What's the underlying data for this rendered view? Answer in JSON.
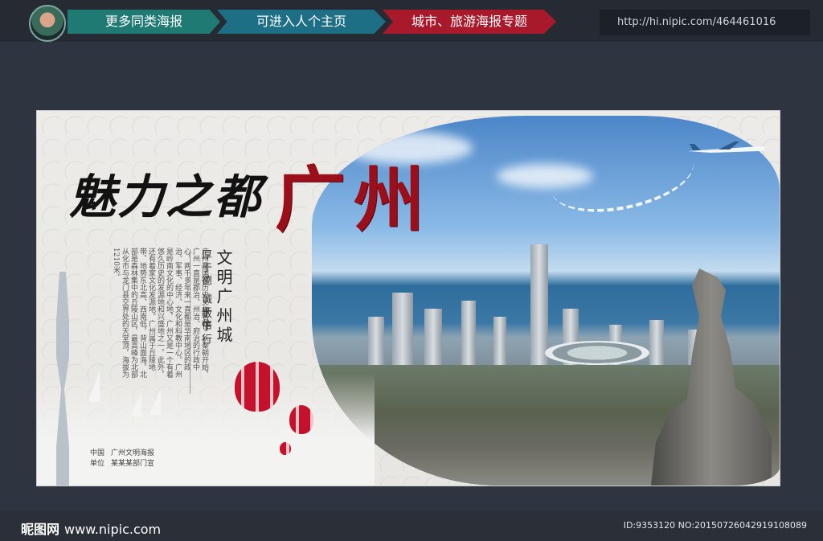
{
  "header": {
    "nav": [
      "更多同类海报",
      "可进入人个主页",
      "城市、旅游海报专题"
    ],
    "url": "http://hi.nipic.com/464461016"
  },
  "poster": {
    "title_black": "魅力之都",
    "title_red": "广州",
    "slogan": "文明广州城",
    "sub1": "厚于德 诚于信",
    "sub2": "敏于行",
    "body": "广州是国家历史文化名城，从秦朝开始，广州一直是郡治、州治、府治的行政中心，两千多年来一直都是华南地区的政治、军事、经济、文化和科教中心。广州是岭南文化的中心地，广州又是一个有着悠久历史的发源地和兴盛地之一，此外，还有着家文化发源地。广州属于丘陵地带，地势东北高、西南低，背山面海，北部是森林集中的丘陵山区，最高峰为北部从化市与龙门县交界处的天堂顶，海拔为1210米。",
    "credits": [
      {
        "label": "中国",
        "value": "广州文明海报"
      },
      {
        "label": "单位",
        "value": "某某某部门宣"
      }
    ],
    "colors": {
      "title_red": "#9b0f1a"
    }
  },
  "footer": {
    "brand": "昵图网",
    "brand_url": "www.nipic.com",
    "id": "ID:9353120 NO:20150726042919108089"
  }
}
